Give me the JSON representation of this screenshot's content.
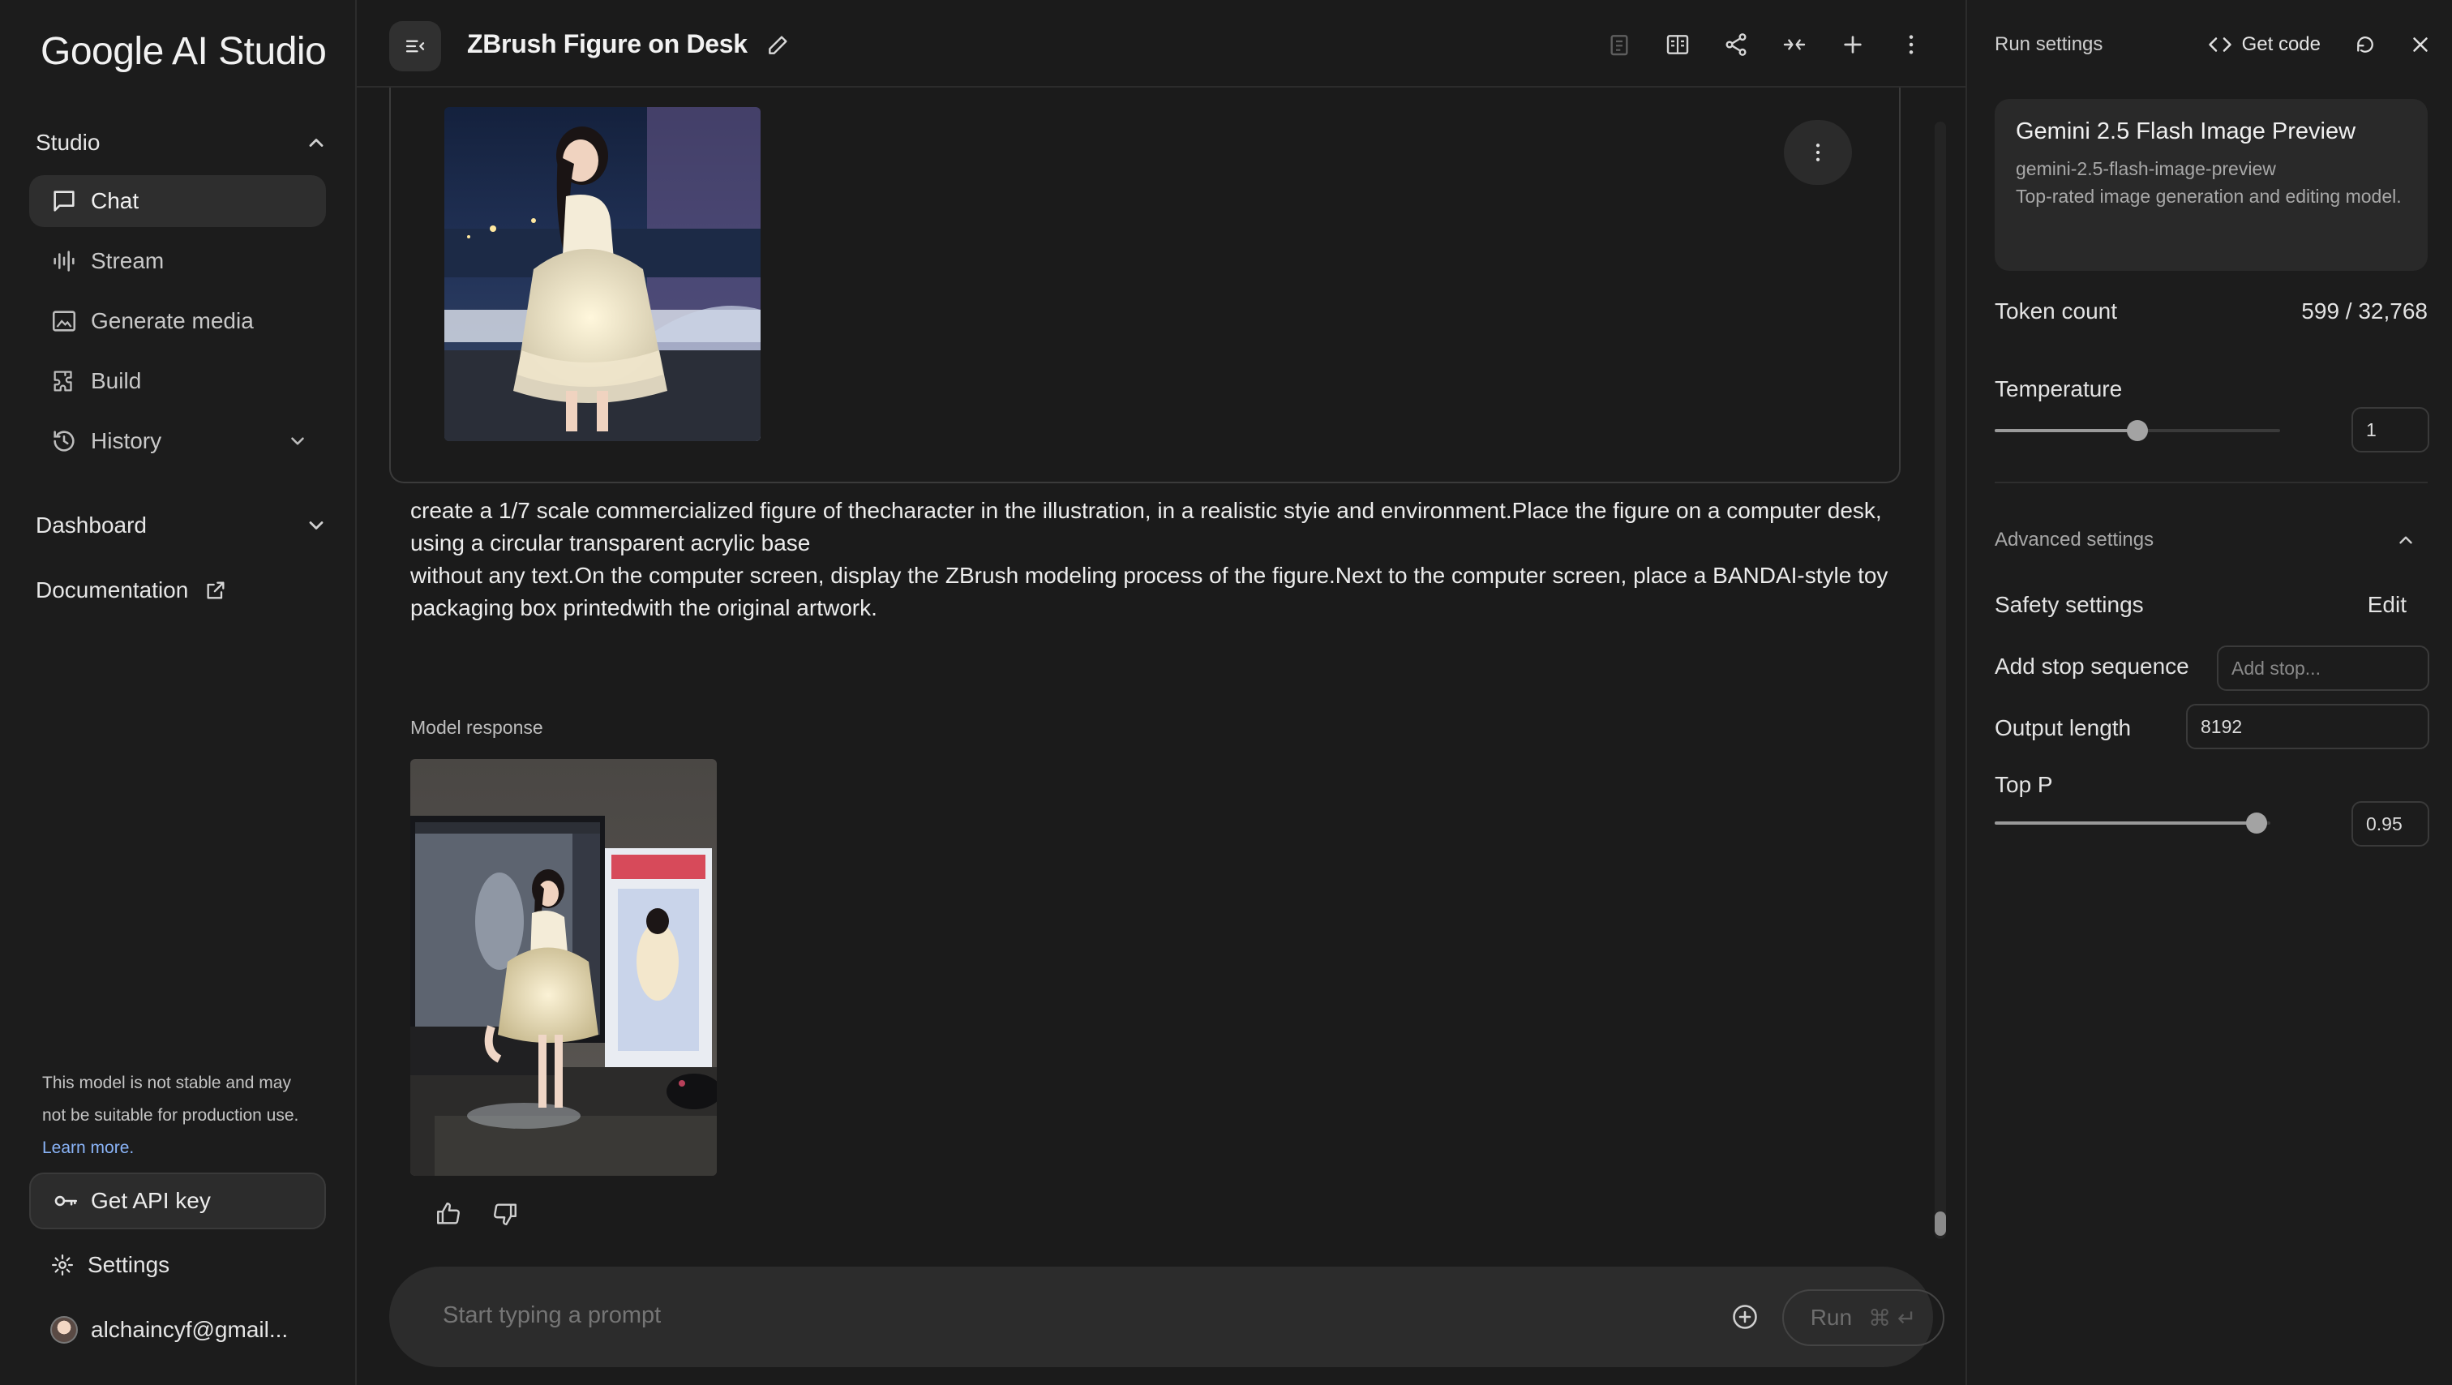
{
  "app": {
    "logo_text": "Google AI Studio"
  },
  "sidebar": {
    "studio_label": "Studio",
    "items": [
      {
        "label": "Chat",
        "icon": "chat-icon"
      },
      {
        "label": "Stream",
        "icon": "stream-icon"
      },
      {
        "label": "Generate media",
        "icon": "image-icon"
      },
      {
        "label": "Build",
        "icon": "puzzle-icon"
      },
      {
        "label": "History",
        "icon": "history-icon"
      }
    ],
    "dashboard_label": "Dashboard",
    "documentation_label": "Documentation",
    "warning_text": "This model is not stable and may not be suitable for production use.",
    "warning_link": "Learn more.",
    "api_key_label": "Get API key",
    "settings_label": "Settings",
    "account_label": "alchaincyf@gmail..."
  },
  "header": {
    "title": "ZBrush Figure on Desk"
  },
  "conversation": {
    "user_prompt": "create a 1/7 scale commercialized figure of thecharacter in the illustration, in a realistic styie and environment.Place the figure on a computer desk, using a circular transparent acrylic base\nwithout any text.On the computer screen, display the ZBrush modeling process of the figure.Next to the computer screen, place a BANDAI-style toy packaging box printedwith the original artwork.",
    "model_response_label": "Model response"
  },
  "input": {
    "placeholder": "Start typing a prompt",
    "run_label": "Run",
    "run_shortcut": "⌘ ↵"
  },
  "run_settings": {
    "title": "Run settings",
    "get_code_label": "Get code",
    "model": {
      "name": "Gemini 2.5 Flash Image Preview",
      "id": "gemini-2.5-flash-image-preview",
      "description": "Top-rated image generation and editing model."
    },
    "token_count_label": "Token count",
    "token_count_value": "599 / 32,768",
    "temperature_label": "Temperature",
    "temperature_value": "1",
    "temperature_fraction": 0.5,
    "advanced_settings_label": "Advanced settings",
    "safety_settings_label": "Safety settings",
    "safety_edit_label": "Edit",
    "stop_sequence_label": "Add stop sequence",
    "stop_sequence_placeholder": "Add stop...",
    "output_length_label": "Output length",
    "output_length_value": "8192",
    "top_p_label": "Top P",
    "top_p_value": "0.95",
    "top_p_fraction": 0.95
  },
  "colors": {
    "background": "#1b1b1b",
    "panel": "#292929",
    "link": "#8ab4f8",
    "text": "#e3e3e3"
  }
}
